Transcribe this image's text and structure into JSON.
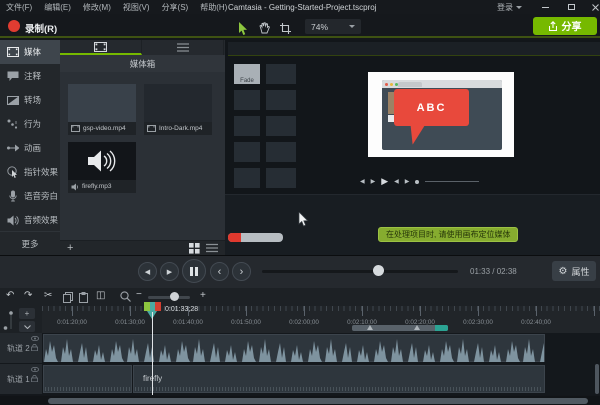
{
  "menu": {
    "items": [
      "文件(F)",
      "编辑(E)",
      "修改(M)",
      "视图(V)",
      "分享(S)",
      "帮助(H)"
    ],
    "title": "Camtasia - Getting-Started-Project.tscproj",
    "sign_in": "登录"
  },
  "toolbar": {
    "record_label": "录制(R)",
    "zoom_level": "74%",
    "share_label": "分享"
  },
  "sidebar": {
    "items": [
      "媒体",
      "注释",
      "转场",
      "行为",
      "动画",
      "指针效果",
      "语音旁白",
      "音频效果"
    ],
    "more_label": "更多"
  },
  "media_bin": {
    "title": "媒体箱",
    "items": [
      {
        "name": "gsp-video.mp4",
        "type": "video"
      },
      {
        "name": "Intro-Dark.mp4",
        "type": "video"
      },
      {
        "name": "firefly.mp3",
        "type": "audio"
      }
    ]
  },
  "canvas": {
    "transition_label": "Fade",
    "callout_text": "ABC",
    "tip_text": "在处理项目时, 请使用画布定位媒体"
  },
  "preview": {
    "time_current": "01:33",
    "time_separator": "/",
    "time_total": "02:38",
    "properties_label": "属性"
  },
  "timeline": {
    "playhead_time": "0:01:33;28",
    "ticks": [
      "0:01:20;00",
      "0:01:30;00",
      "0:01:40;00",
      "0:01:50;00",
      "0:02:00;00",
      "0:02:10;00",
      "0:02:20;00",
      "0:02:30;00",
      "0:02:40;00"
    ],
    "tracks": [
      {
        "name": "轨道 2"
      },
      {
        "name": "轨道 1"
      }
    ],
    "clip_label": "firefly"
  },
  "icons": {
    "plus": "+",
    "minus": "−",
    "undo": "↶",
    "redo": "↷",
    "cut": "✂",
    "split": "◫",
    "gear": "⚙",
    "prev": "‹",
    "next": "›",
    "play_small": "▶",
    "back_small": "◀",
    "step_back": "◀",
    "step_fwd": "▶",
    "chevron": "ˬ"
  },
  "colors": {
    "accent_green": "#76b900",
    "record_red": "#e03c31",
    "callout_red": "#e8493c",
    "tip_green": "#86ac2f",
    "playhead_teal": "#4aa9a2",
    "waveform": "#7e939f"
  }
}
